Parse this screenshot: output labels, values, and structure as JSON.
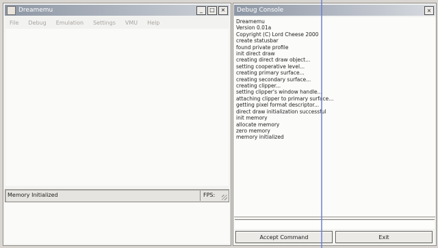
{
  "main_window": {
    "title": "Dreamemu",
    "controls": {
      "minimize": "_",
      "maximize": "□",
      "close": "×"
    },
    "menu": [
      "File",
      "Debug",
      "Emulation",
      "Settings",
      "VMU",
      "Help"
    ],
    "status": {
      "message": "Memory Initialized",
      "fps_label": "FPS:"
    }
  },
  "debug_console": {
    "title": "Debug Console",
    "close": "×",
    "log": [
      "Dreamemu",
      "Version 0.01a",
      "Copyright (C) Lord Cheese 2000",
      "create statusbar",
      "found private profile",
      "init direct draw",
      "creating direct draw object...",
      "setting cooperative level...",
      "creating primary surface...",
      "creating secondary surface...",
      "creating clipper...",
      "setting clipper's window handle...",
      "attaching clipper to primary surface...",
      "getting pixel format descriptor...",
      "direct draw initialization successful",
      "init memory",
      "allocate memory",
      "zero memory",
      "memory initialized"
    ],
    "command_value": "",
    "accept_label": "Accept Command",
    "exit_label": "Exit"
  },
  "colors": {
    "titlebar_start": "#8d96a4",
    "titlebar_end": "#cfd3d9",
    "window_bg": "#f2f2f0",
    "artifact_line": "#6b7fd0"
  }
}
